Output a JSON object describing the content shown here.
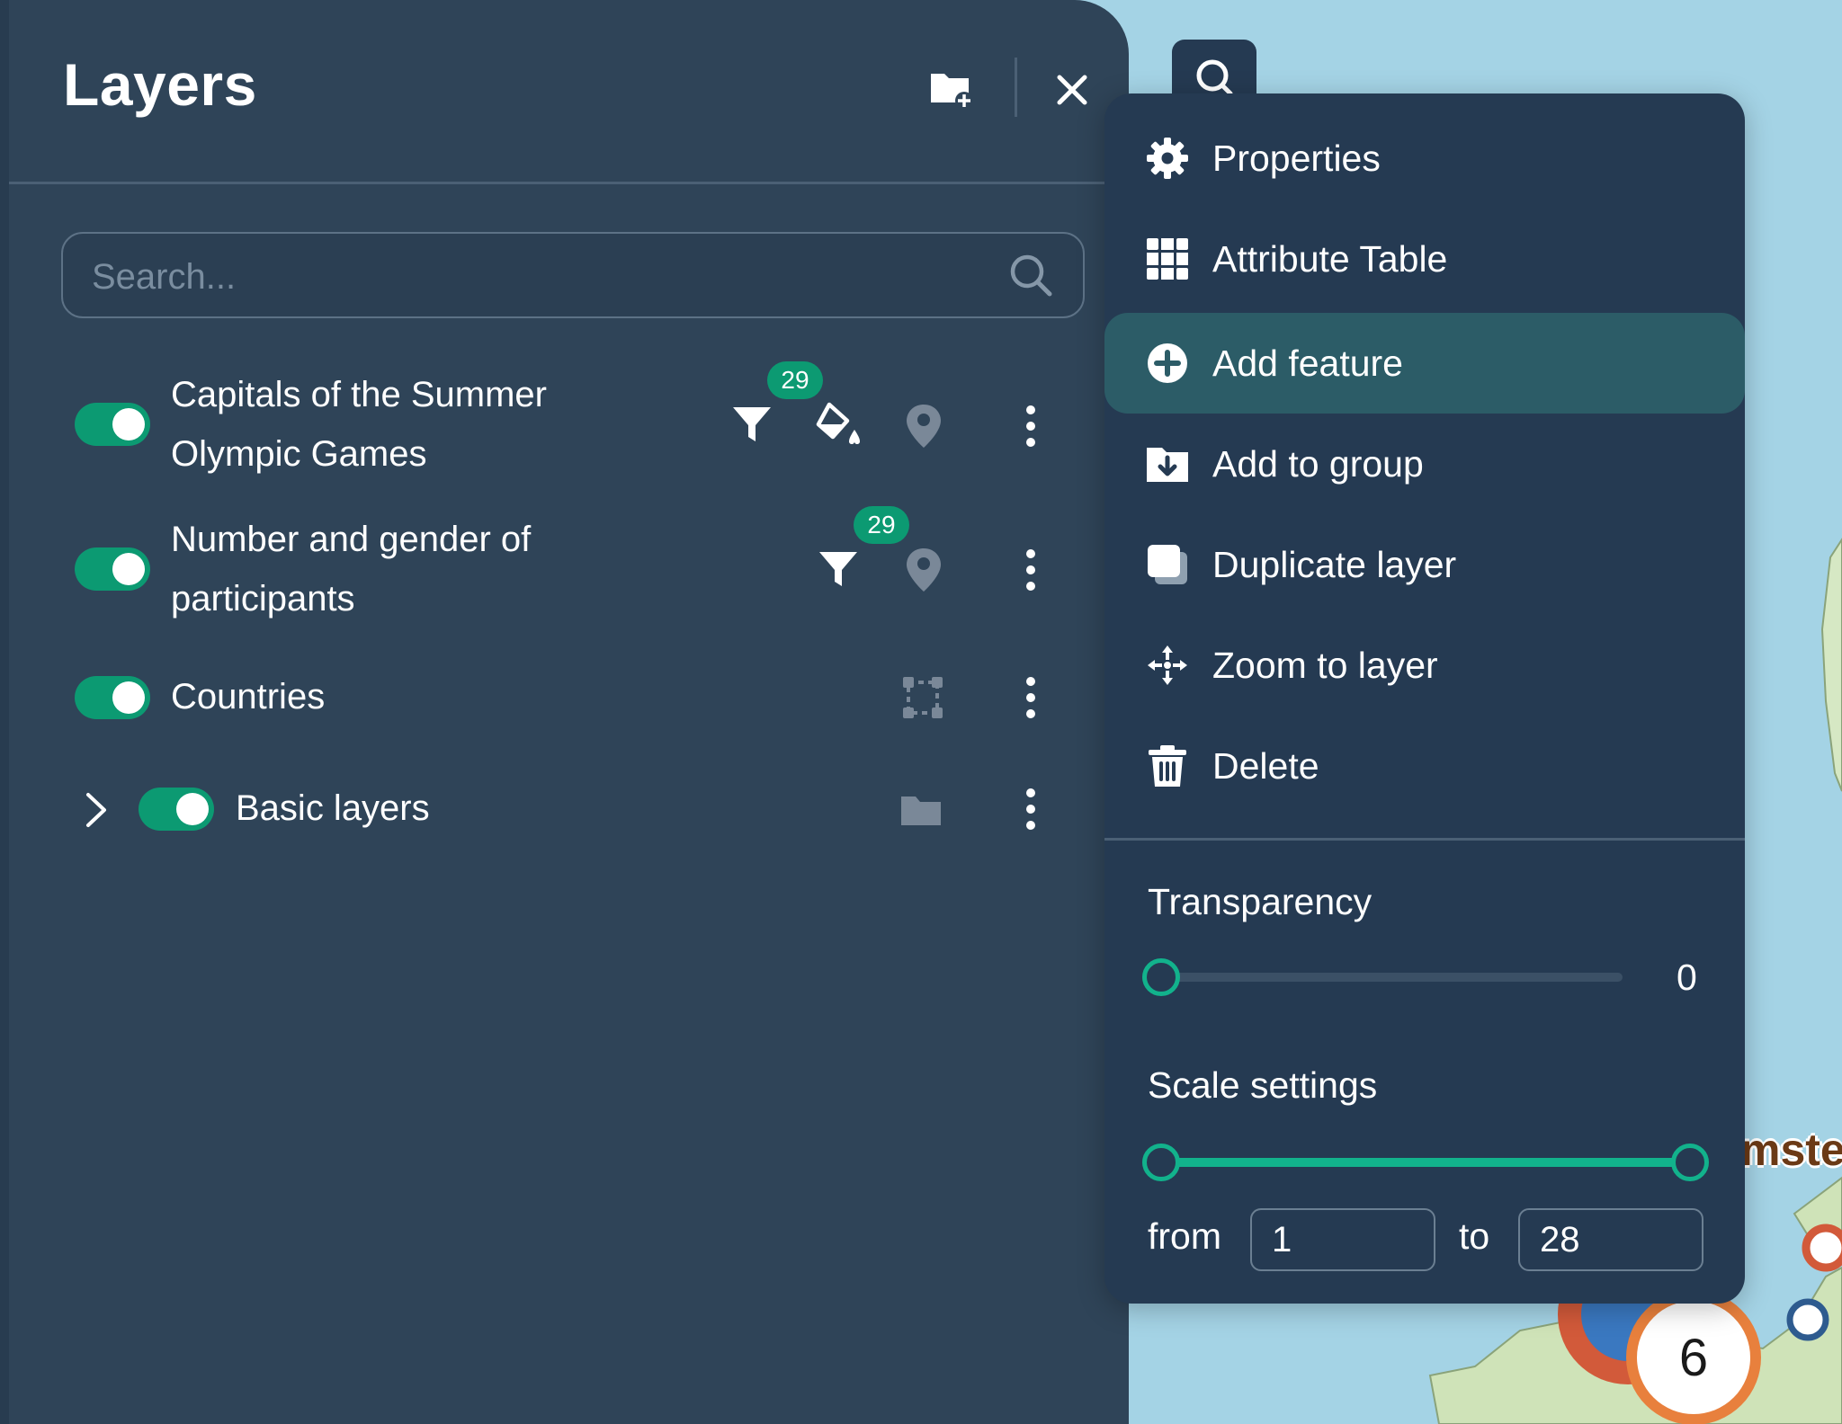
{
  "panel": {
    "title": "Layers",
    "search_placeholder": "Search..."
  },
  "layers": [
    {
      "name_line1": "Capitals of the Summer",
      "name_line2": "Olympic Games",
      "enabled": true,
      "filter_count": "29"
    },
    {
      "name_line1": "Number and gender of",
      "name_line2": "participants",
      "enabled": true,
      "filter_count": "29"
    },
    {
      "name": "Countries",
      "enabled": true
    },
    {
      "name": "Basic layers",
      "enabled": true,
      "is_group": true
    }
  ],
  "menu": {
    "items": [
      {
        "label": "Properties",
        "icon": "gear-icon"
      },
      {
        "label": "Attribute Table",
        "icon": "table-icon"
      },
      {
        "label": "Add feature",
        "icon": "plus-circle-icon",
        "active": true
      },
      {
        "label": "Add to group",
        "icon": "folder-download-icon"
      },
      {
        "label": "Duplicate layer",
        "icon": "duplicate-icon"
      },
      {
        "label": "Zoom to layer",
        "icon": "zoom-arrows-icon"
      },
      {
        "label": "Delete",
        "icon": "trash-icon"
      }
    ],
    "transparency": {
      "label": "Transparency",
      "value": "0"
    },
    "scale": {
      "label": "Scale settings",
      "from_label": "from",
      "from_value": "1",
      "to_label": "to",
      "to_value": "28"
    }
  },
  "map": {
    "city_label_fragment": "mster",
    "cluster_count": "6"
  },
  "colors": {
    "panel_bg": "#2f4458",
    "menu_bg": "#253a52",
    "accent": "#0c9a72",
    "active_item": "#2c5c67",
    "map_water": "#a4d3e5"
  }
}
